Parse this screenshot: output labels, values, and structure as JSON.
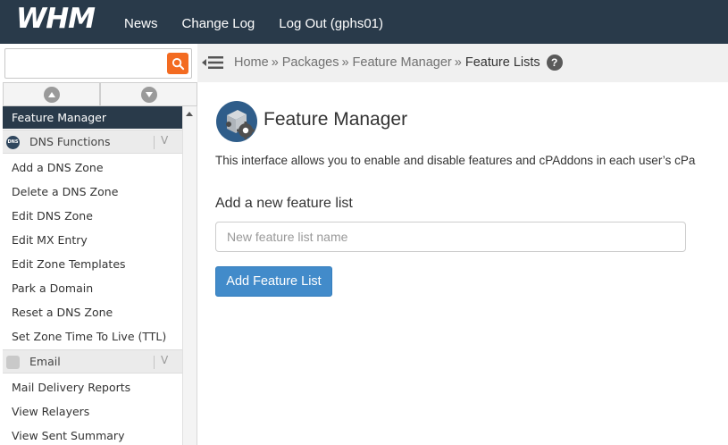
{
  "header": {
    "logo_text": "WHM",
    "nav": [
      {
        "label": "News"
      },
      {
        "label": "Change Log"
      },
      {
        "label": "Log Out (gphs01)"
      }
    ]
  },
  "sidebar": {
    "search": {
      "value": "",
      "placeholder": ""
    },
    "active_item": "Feature Manager",
    "categories": [
      {
        "label": "DNS Functions",
        "icon": "dns-icon",
        "icon_text": "DNS",
        "items": [
          "Add a DNS Zone",
          "Delete a DNS Zone",
          "Edit DNS Zone",
          "Edit MX Entry",
          "Edit Zone Templates",
          "Park a Domain",
          "Reset a DNS Zone",
          "Set Zone Time To Live (TTL)"
        ]
      },
      {
        "label": "Email",
        "icon": "email-icon",
        "items": [
          "Mail Delivery Reports",
          "View Relayers",
          "View Sent Summary"
        ]
      }
    ],
    "chevron": "V"
  },
  "breadcrumb": {
    "items": [
      "Home",
      "Packages",
      "Feature Manager"
    ],
    "separator": "»",
    "current": "Feature Lists",
    "help": "?"
  },
  "main": {
    "title": "Feature Manager",
    "description": "This interface allows you to enable and disable features and cPAddons in each user’s cPa",
    "add_label": "Add a new feature list",
    "input": {
      "value": "",
      "placeholder": "New feature list name"
    },
    "button_label": "Add Feature List"
  },
  "colors": {
    "topbar": "#293a4a",
    "search_button": "#f36b21",
    "primary_button": "#428bca",
    "crumb_bar": "#f0f0f0"
  }
}
